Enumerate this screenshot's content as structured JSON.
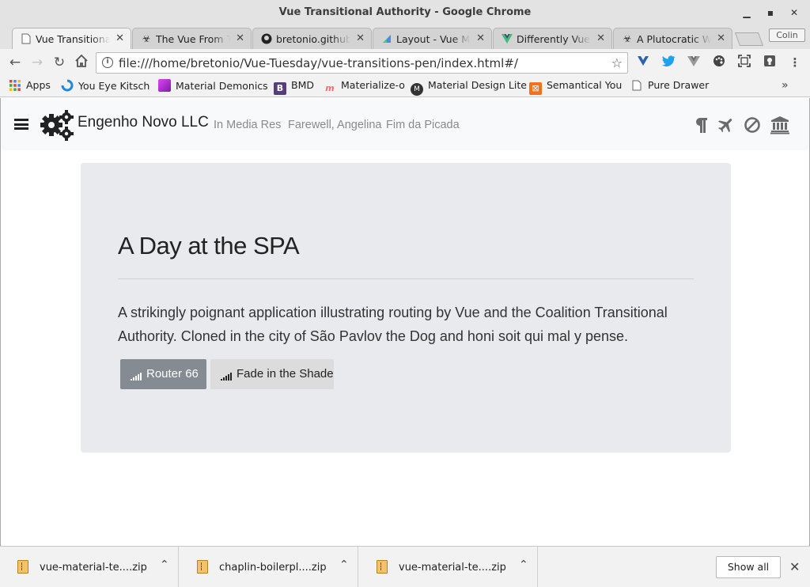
{
  "window": {
    "title": "Vue Transitional Authority - Google Chrome",
    "minimize": "‗",
    "maximize": "▪",
    "close": "✕"
  },
  "tabs": [
    {
      "label": "Vue Transitional Authority",
      "icon": "page-icon",
      "active": true
    },
    {
      "label": "The Vue From The",
      "icon": "biohazard-icon"
    },
    {
      "label": "bretonio.github.io",
      "icon": "github-icon"
    },
    {
      "label": "Layout - Vue Material",
      "icon": "vue-material-icon"
    },
    {
      "label": "Differently Vue",
      "icon": "vue-icon"
    },
    {
      "label": "A Plutocratic World",
      "icon": "biohazard-icon"
    }
  ],
  "profile": "Colin",
  "toolbar": {
    "url": "file:///home/bretonio/Vue-Tuesday/vue-transitions-pen/index.html#/"
  },
  "bookmarks": [
    {
      "label": "Apps",
      "icon": "apps-grid-icon"
    },
    {
      "label": "You Eye Kitsch",
      "icon": "loading-ring-icon"
    },
    {
      "label": "Material Demonics",
      "icon": "material-square-icon"
    },
    {
      "label": "BMD",
      "icon": "bootstrap-b-icon"
    },
    {
      "label": "Materialize-o",
      "icon": "materialize-m-icon"
    },
    {
      "label": "Material Design Lite",
      "icon": "mdl-m-icon"
    },
    {
      "label": "Semantical You",
      "icon": "semantic-icon"
    },
    {
      "label": "Pure Drawer",
      "icon": "page-icon"
    }
  ],
  "bookmarks_overflow": "»",
  "site": {
    "brand": "Engenho Novo LLC",
    "nav": [
      "In Media Res",
      "Farewell, Angelina",
      "Fim da Picada"
    ],
    "nav_icons": [
      "pilcrow-icon",
      "plane-icon",
      "ban-icon",
      "bank-icon"
    ]
  },
  "jumbotron": {
    "title": "A Day at the SPA",
    "text": "A strikingly poignant application illustrating routing by Vue and the Coalition Transitional Authority. Cloned in the city of São Pavlov the Dog and honi soit qui mal y pense.",
    "primary_button": "Router 66",
    "secondary_button": "Fade in the Shade"
  },
  "downloads": [
    {
      "name": "vue-material-te....zip"
    },
    {
      "name": "chaplin-boilerpl....zip"
    },
    {
      "name": "vue-material-te....zip"
    }
  ],
  "shelf": {
    "show_all": "Show all"
  }
}
